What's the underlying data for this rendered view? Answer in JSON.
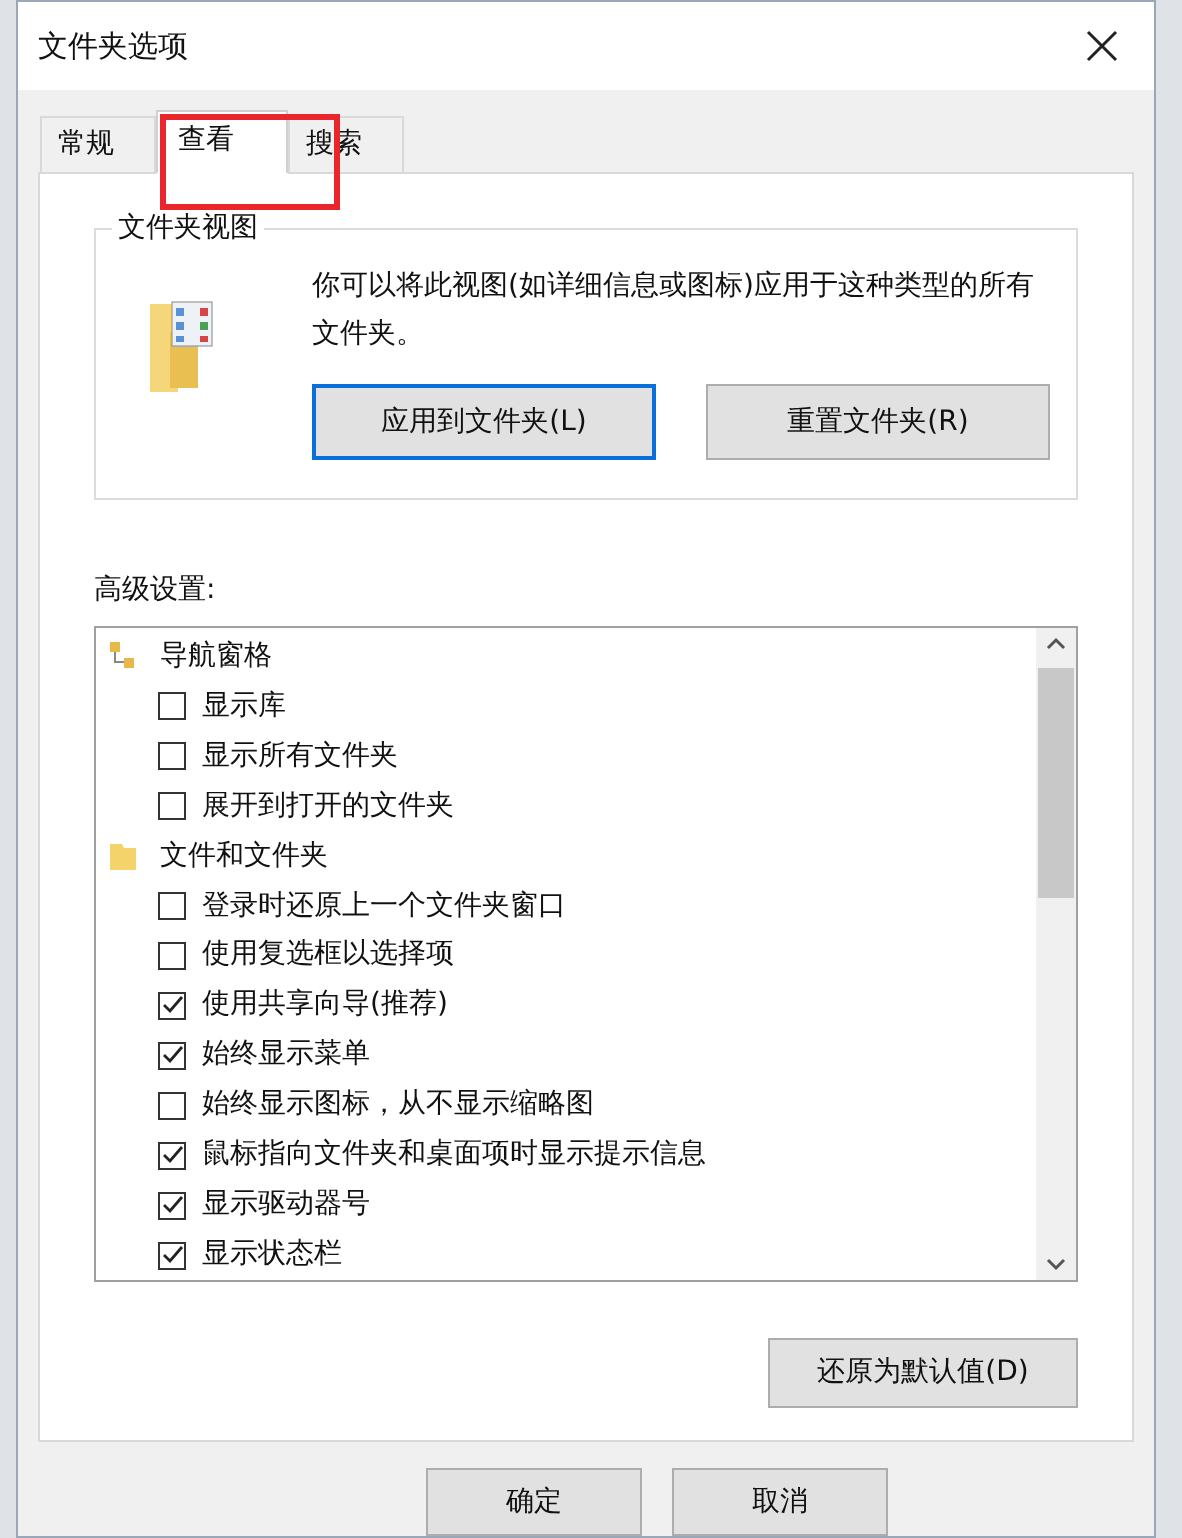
{
  "window": {
    "title": "文件夹选项"
  },
  "tabs": [
    {
      "label": "常规",
      "selected": false
    },
    {
      "label": "查看",
      "selected": true
    },
    {
      "label": "搜索",
      "selected": false
    }
  ],
  "highlight": {
    "on": true
  },
  "folder_views": {
    "title": "文件夹视图",
    "description": "你可以将此视图(如详细信息或图标)应用于这种类型的所有文件夹。",
    "buttons": [
      {
        "label": "应用到文件夹(L)",
        "selected": true
      },
      {
        "label": "重置文件夹(R)",
        "selected": false
      }
    ]
  },
  "advanced": {
    "label": "高级设置:",
    "items": [
      {
        "kind": "group",
        "label": "导航窗格",
        "children": [
          {
            "kind": "checkbox",
            "label": "显示库",
            "checked": false
          },
          {
            "kind": "checkbox",
            "label": "显示所有文件夹",
            "checked": false
          },
          {
            "kind": "checkbox",
            "label": "展开到打开的文件夹",
            "checked": false
          }
        ]
      },
      {
        "kind": "group",
        "label": "文件和文件夹",
        "children": [
          {
            "kind": "checkbox",
            "label": "登录时还原上一个文件夹窗口",
            "checked": false
          },
          {
            "kind": "checkbox",
            "label": "使用复选框以选择项",
            "checked": false
          },
          {
            "kind": "checkbox",
            "label": "使用共享向导(推荐)",
            "checked": true
          },
          {
            "kind": "checkbox",
            "label": "始终显示菜单",
            "checked": true
          },
          {
            "kind": "checkbox",
            "label": "始终显示图标，从不显示缩略图",
            "checked": false
          },
          {
            "kind": "checkbox",
            "label": "鼠标指向文件夹和桌面项时显示提示信息",
            "checked": true
          },
          {
            "kind": "checkbox",
            "label": "显示驱动器号",
            "checked": true
          },
          {
            "kind": "checkbox",
            "label": "显示状态栏",
            "checked": true
          }
        ]
      }
    ]
  },
  "restore_button": "还原为默认值(D)",
  "buttons": [
    "确定",
    "取消"
  ]
}
